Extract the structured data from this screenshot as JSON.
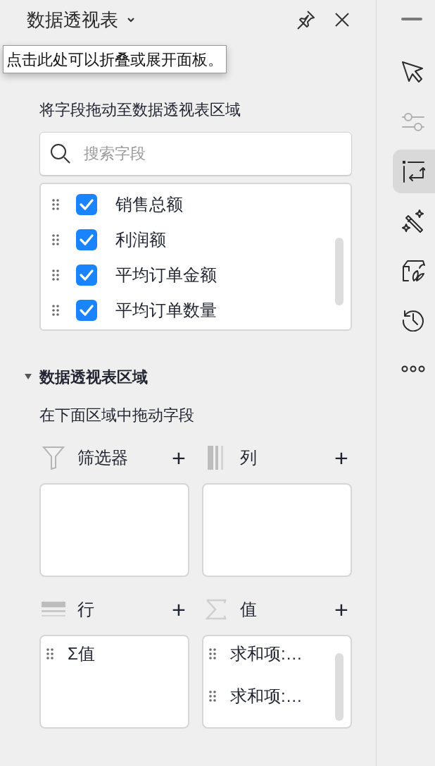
{
  "panel": {
    "title": "数据透视表",
    "tooltip": "点击此处可以折叠或展开面板。"
  },
  "field_list": {
    "hint": "将字段拖动至数据透视表区域",
    "search": {
      "placeholder": "搜索字段"
    },
    "fields": [
      {
        "label": "销售总额",
        "checked": true
      },
      {
        "label": "利润额",
        "checked": true
      },
      {
        "label": "平均订单金额",
        "checked": true
      },
      {
        "label": "平均订单数量",
        "checked": true
      }
    ]
  },
  "areas_section": {
    "title": "数据透视表区域",
    "expanded": true,
    "hint": "在下面区域中拖动字段",
    "areas": [
      {
        "kind": "filter",
        "label": "筛选器",
        "add": "+"
      },
      {
        "kind": "columns",
        "label": "列",
        "add": "+"
      },
      {
        "kind": "rows",
        "label": "行",
        "add": "+",
        "items": [
          "Σ值"
        ]
      },
      {
        "kind": "values",
        "label": "值",
        "add": "+",
        "items": [
          "求和项:…",
          "求和项:…"
        ]
      }
    ]
  },
  "toolbar": [
    {
      "kind": "minimize",
      "selected": false,
      "disabled": false
    },
    {
      "kind": "pointer",
      "selected": false,
      "disabled": false
    },
    {
      "kind": "sliders",
      "selected": false,
      "disabled": true
    },
    {
      "kind": "pivot",
      "selected": true,
      "disabled": false
    },
    {
      "kind": "magic",
      "selected": false,
      "disabled": false
    },
    {
      "kind": "shop",
      "selected": false,
      "disabled": false
    },
    {
      "kind": "history",
      "selected": false,
      "disabled": false
    },
    {
      "kind": "more",
      "selected": false,
      "disabled": false
    }
  ]
}
